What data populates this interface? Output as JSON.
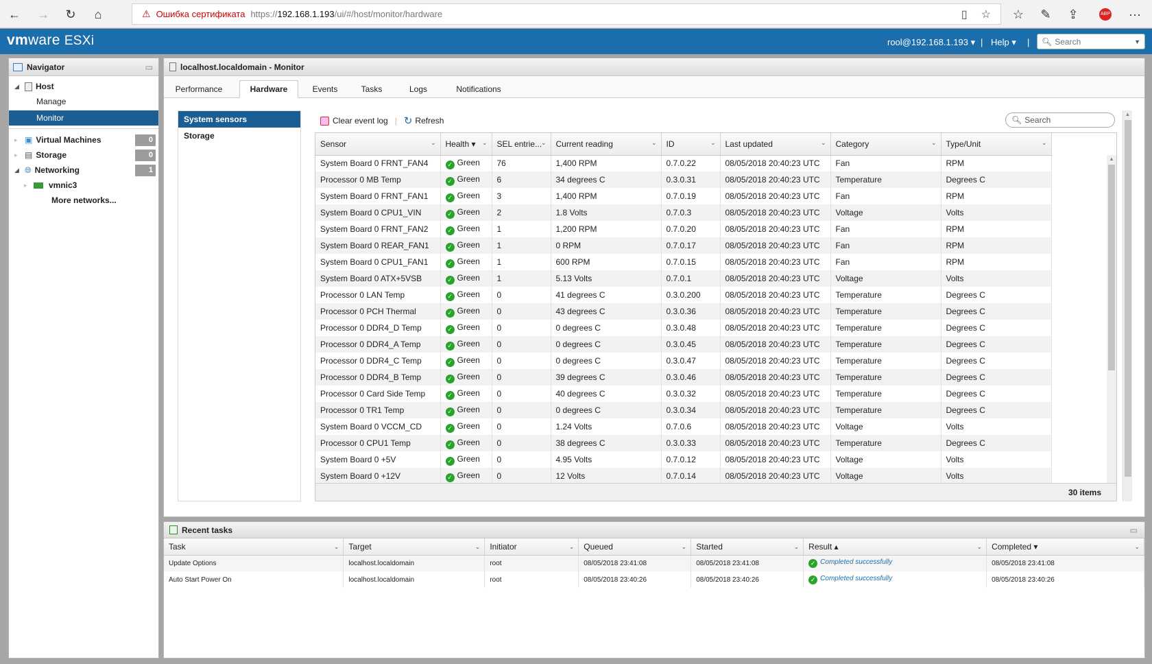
{
  "browser": {
    "cert_error": "Ошибка сертификата",
    "url_scheme": "https://",
    "url_host": "192.168.1.193",
    "url_path": "/ui/#/host/monitor/hardware"
  },
  "header": {
    "logo_vm": "vm",
    "logo_ware": "ware",
    "logo_esxi": "ESXi",
    "user": "rool@192.168.1.193",
    "help": "Help",
    "separator": "|",
    "search_placeholder": "Search"
  },
  "navigator": {
    "title": "Navigator",
    "items": [
      {
        "label": "Host",
        "count": ""
      },
      {
        "label": "Manage",
        "count": ""
      },
      {
        "label": "Monitor",
        "count": ""
      },
      {
        "label": "Virtual Machines",
        "count": "0"
      },
      {
        "label": "Storage",
        "count": "0"
      },
      {
        "label": "Networking",
        "count": "1"
      },
      {
        "label": "vmnic3",
        "count": ""
      },
      {
        "label": "More networks...",
        "count": ""
      }
    ]
  },
  "main": {
    "title": "localhost.localdomain - Monitor",
    "tabs": [
      "Performance",
      "Hardware",
      "Events",
      "Tasks",
      "Logs",
      "Notifications"
    ],
    "active_tab": "Hardware",
    "subnav": [
      "System sensors",
      "Storage"
    ],
    "toolbar": {
      "clear": "Clear event log",
      "refresh": "Refresh",
      "search_placeholder": "Search"
    },
    "columns": [
      "Sensor",
      "Health ▾",
      "SEL entrie...",
      "Current reading",
      "ID",
      "Last updated",
      "Category",
      "Type/Unit"
    ],
    "rows": [
      [
        "System Board 0 FRNT_FAN4",
        "Green",
        "76",
        "1,400 RPM",
        "0.7.0.22",
        "08/05/2018 20:40:23 UTC",
        "Fan",
        "RPM"
      ],
      [
        "Processor 0 MB Temp",
        "Green",
        "6",
        "34 degrees C",
        "0.3.0.31",
        "08/05/2018 20:40:23 UTC",
        "Temperature",
        "Degrees C"
      ],
      [
        "System Board 0 FRNT_FAN1",
        "Green",
        "3",
        "1,400 RPM",
        "0.7.0.19",
        "08/05/2018 20:40:23 UTC",
        "Fan",
        "RPM"
      ],
      [
        "System Board 0 CPU1_VIN",
        "Green",
        "2",
        "1.8 Volts",
        "0.7.0.3",
        "08/05/2018 20:40:23 UTC",
        "Voltage",
        "Volts"
      ],
      [
        "System Board 0 FRNT_FAN2",
        "Green",
        "1",
        "1,200 RPM",
        "0.7.0.20",
        "08/05/2018 20:40:23 UTC",
        "Fan",
        "RPM"
      ],
      [
        "System Board 0 REAR_FAN1",
        "Green",
        "1",
        "0 RPM",
        "0.7.0.17",
        "08/05/2018 20:40:23 UTC",
        "Fan",
        "RPM"
      ],
      [
        "System Board 0 CPU1_FAN1",
        "Green",
        "1",
        "600 RPM",
        "0.7.0.15",
        "08/05/2018 20:40:23 UTC",
        "Fan",
        "RPM"
      ],
      [
        "System Board 0 ATX+5VSB",
        "Green",
        "1",
        "5.13 Volts",
        "0.7.0.1",
        "08/05/2018 20:40:23 UTC",
        "Voltage",
        "Volts"
      ],
      [
        "Processor 0 LAN Temp",
        "Green",
        "0",
        "41 degrees C",
        "0.3.0.200",
        "08/05/2018 20:40:23 UTC",
        "Temperature",
        "Degrees C"
      ],
      [
        "Processor 0 PCH Thermal",
        "Green",
        "0",
        "43 degrees C",
        "0.3.0.36",
        "08/05/2018 20:40:23 UTC",
        "Temperature",
        "Degrees C"
      ],
      [
        "Processor 0 DDR4_D Temp",
        "Green",
        "0",
        "0 degrees C",
        "0.3.0.48",
        "08/05/2018 20:40:23 UTC",
        "Temperature",
        "Degrees C"
      ],
      [
        "Processor 0 DDR4_A Temp",
        "Green",
        "0",
        "0 degrees C",
        "0.3.0.45",
        "08/05/2018 20:40:23 UTC",
        "Temperature",
        "Degrees C"
      ],
      [
        "Processor 0 DDR4_C Temp",
        "Green",
        "0",
        "0 degrees C",
        "0.3.0.47",
        "08/05/2018 20:40:23 UTC",
        "Temperature",
        "Degrees C"
      ],
      [
        "Processor 0 DDR4_B Temp",
        "Green",
        "0",
        "39 degrees C",
        "0.3.0.46",
        "08/05/2018 20:40:23 UTC",
        "Temperature",
        "Degrees C"
      ],
      [
        "Processor 0 Card Side Temp",
        "Green",
        "0",
        "40 degrees C",
        "0.3.0.32",
        "08/05/2018 20:40:23 UTC",
        "Temperature",
        "Degrees C"
      ],
      [
        "Processor 0 TR1 Temp",
        "Green",
        "0",
        "0 degrees C",
        "0.3.0.34",
        "08/05/2018 20:40:23 UTC",
        "Temperature",
        "Degrees C"
      ],
      [
        "System Board 0 VCCM_CD",
        "Green",
        "0",
        "1.24 Volts",
        "0.7.0.6",
        "08/05/2018 20:40:23 UTC",
        "Voltage",
        "Volts"
      ],
      [
        "Processor 0 CPU1 Temp",
        "Green",
        "0",
        "38 degrees C",
        "0.3.0.33",
        "08/05/2018 20:40:23 UTC",
        "Temperature",
        "Degrees C"
      ],
      [
        "System Board 0 +5V",
        "Green",
        "0",
        "4.95 Volts",
        "0.7.0.12",
        "08/05/2018 20:40:23 UTC",
        "Voltage",
        "Volts"
      ],
      [
        "System Board 0 +12V",
        "Green",
        "0",
        "12 Volts",
        "0.7.0.14",
        "08/05/2018 20:40:23 UTC",
        "Voltage",
        "Volts"
      ]
    ],
    "footer": "30 items"
  },
  "tasks": {
    "title": "Recent tasks",
    "columns": [
      "Task",
      "Target",
      "Initiator",
      "Queued",
      "Started",
      "Result ▴",
      "Completed ▾"
    ],
    "rows": [
      [
        "Update Options",
        "localhost.localdomain",
        "root",
        "08/05/2018 23:41:08",
        "08/05/2018 23:41:08",
        "Completed successfully",
        "08/05/2018 23:41:08"
      ],
      [
        "Auto Start Power On",
        "localhost.localdomain",
        "root",
        "08/05/2018 23:40:26",
        "08/05/2018 23:40:26",
        "Completed successfully",
        "08/05/2018 23:40:26"
      ]
    ]
  },
  "colors": {
    "header": "#1b6eab",
    "selected": "#1b5e93",
    "ok": "#2aa329"
  }
}
